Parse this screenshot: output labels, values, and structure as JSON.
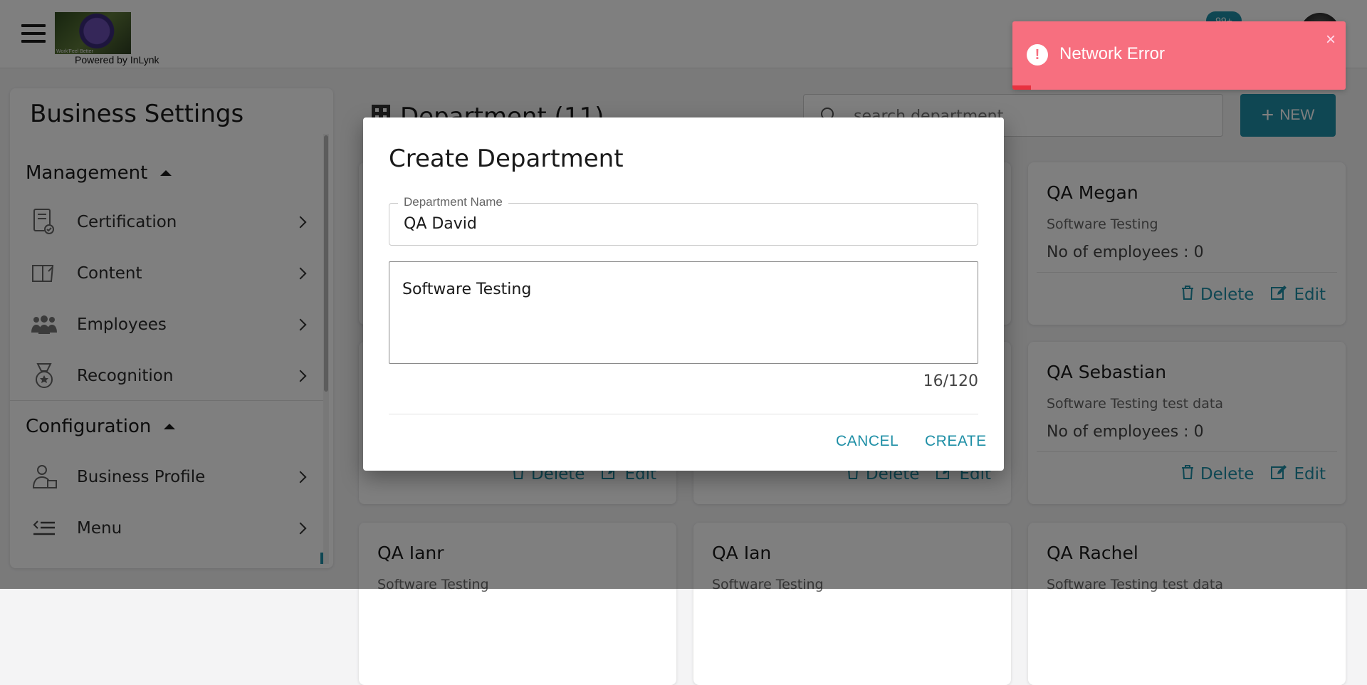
{
  "header": {
    "logo_caption": "Work'Feel Better",
    "powered_by": "Powered by InLynk",
    "notification_count": "99+"
  },
  "sidebar": {
    "title": "Business Settings",
    "sections": [
      {
        "label": "Management",
        "items": [
          {
            "label": "Certification",
            "icon": "certificate-icon"
          },
          {
            "label": "Content",
            "icon": "book-icon"
          },
          {
            "label": "Employees",
            "icon": "people-icon"
          },
          {
            "label": "Recognition",
            "icon": "medal-icon"
          }
        ]
      },
      {
        "label": "Configuration",
        "items": [
          {
            "label": "Business Profile",
            "icon": "business-profile-icon"
          },
          {
            "label": "Menu",
            "icon": "menu-list-icon"
          }
        ]
      }
    ]
  },
  "main": {
    "title": "Department (11)",
    "search_placeholder": "search department",
    "new_label": "NEW",
    "employees_label": "No of employees :",
    "delete_label": "Delete",
    "edit_label": "Edit",
    "cards": [
      {
        "name": "QA Megan",
        "description": "Software Testing",
        "employees": "0"
      },
      {
        "name": "QA Sebastian",
        "description": "Software Testing test data",
        "employees": "0"
      },
      {
        "name": "QA Ianr",
        "description": "Software Testing"
      },
      {
        "name": "QA Ian",
        "description": "Software Testing"
      },
      {
        "name": "QA Rachel",
        "description": "Software Testing test data"
      }
    ]
  },
  "dialog": {
    "title": "Create Department",
    "name_label": "Department Name",
    "name_value": "QA David",
    "description_value": "Software Testing",
    "counter": "16/120",
    "cancel_label": "CANCEL",
    "create_label": "CREATE"
  },
  "toast": {
    "message": "Network Error",
    "icon": "!",
    "close": "×",
    "progress": 0.055
  },
  "colors": {
    "accent": "#1f8fa6",
    "toast_bg": "#f76f7f",
    "toast_progress": "#e8313f"
  }
}
